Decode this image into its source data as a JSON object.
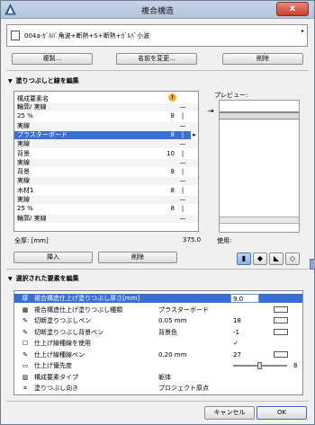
{
  "window": {
    "title": "複合構造",
    "close_label": "x"
  },
  "composite": {
    "name": "004a-ｶﾞﾙﾊﾞ角波+断熱+S+断熱+ｶﾞﾙﾊﾞ小波"
  },
  "top_buttons": {
    "duplicate": "複製...",
    "rename": "名前を変更...",
    "delete": "削除"
  },
  "fill_section": {
    "heading": "塗りつぶしと線を編集",
    "column_header": "構成要素名",
    "preview_label": "プレビュー:",
    "total_label": "全厚: [mm]",
    "total_value": "375.0",
    "usage_label": "使用:",
    "insert_label": "挿入",
    "delete_label": "削除",
    "rows": [
      {
        "label": "輪郭/ 実線",
        "num": "",
        "sym": "—",
        "kind": "line"
      },
      {
        "label": "25 %",
        "num": "8",
        "sym": "|",
        "kind": "fill"
      },
      {
        "label": "実線",
        "num": "",
        "sym": "—",
        "kind": "line"
      },
      {
        "label": "プラスターボード",
        "num": "8",
        "sym": "|",
        "kind": "fill",
        "selected": true
      },
      {
        "label": "実線",
        "num": "",
        "sym": "—",
        "kind": "line"
      },
      {
        "label": "背景",
        "num": "10",
        "sym": "|",
        "kind": "fill"
      },
      {
        "label": "実線",
        "num": "",
        "sym": "—",
        "kind": "line"
      },
      {
        "label": "背景",
        "num": "8",
        "sym": "|",
        "kind": "fill"
      },
      {
        "label": "実線",
        "num": "",
        "sym": "—",
        "kind": "line"
      },
      {
        "label": "木材1",
        "num": "8",
        "sym": "|",
        "kind": "fill"
      },
      {
        "label": "実線",
        "num": "",
        "sym": "—",
        "kind": "line"
      },
      {
        "label": "25 %",
        "num": "8",
        "sym": "|",
        "kind": "fill"
      },
      {
        "label": "輪郭/ 実線",
        "num": "",
        "sym": "—",
        "kind": "line"
      }
    ]
  },
  "props_section": {
    "heading": "選択された要素を編集",
    "rows": [
      {
        "icon": "厚",
        "name": "複合構造仕上げ塗りつぶし厚さ[mm]",
        "value": "",
        "num": "9.0",
        "swatch": false,
        "selected": true
      },
      {
        "icon": "▦",
        "name": "複合構造仕上げ塗りつぶし種類",
        "value": "プラスターボード",
        "num": "",
        "swatch": true
      },
      {
        "icon": "✎",
        "name": "切断塗りつぶしペン",
        "value": "0.05 mm",
        "num": "18",
        "swatch": true
      },
      {
        "icon": "✎",
        "name": "切断塗りつぶし背景ペン",
        "value": "背景色",
        "num": "-1",
        "swatch": true
      },
      {
        "icon": "☐",
        "name": "仕上げ線種線を使用",
        "value": "",
        "num": "✓",
        "swatch": false
      },
      {
        "icon": "✎",
        "name": "仕上げ線種線ペン",
        "value": "0.20 mm",
        "num": "27",
        "swatch": true
      },
      {
        "icon": "▭",
        "name": "仕上げ優先度",
        "value": "",
        "num": "8",
        "swatch": false,
        "slider": true
      },
      {
        "icon": "▥",
        "name": "構成要素タイプ",
        "value": "躯体",
        "num": "",
        "swatch": false
      },
      {
        "icon": "⌗",
        "name": "塗りつぶし向き",
        "value": "プロジェクト原点",
        "num": "",
        "swatch": false
      }
    ]
  },
  "footer": {
    "cancel": "キャンセル",
    "ok": "OK"
  }
}
